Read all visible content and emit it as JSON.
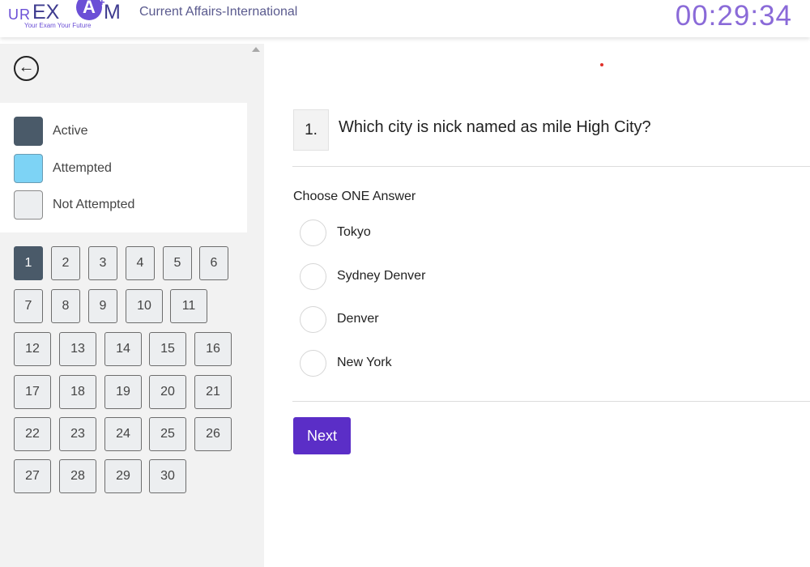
{
  "header": {
    "logo": {
      "ur": "UR",
      "ex": "EX",
      "a": "A",
      "plus": "+",
      "m": "M",
      "tagline": "Your Exam  Your Future"
    },
    "title": "Current Affairs-International",
    "timer": "00:29:34"
  },
  "sidebar": {
    "back_icon": "←",
    "legend": [
      {
        "label": "Active",
        "color": "#4a5a69"
      },
      {
        "label": "Attempted",
        "color": "#7dd3f5"
      },
      {
        "label": "Not Attempted",
        "color": "#eceef0"
      }
    ],
    "question_numbers": [
      [
        "1",
        "2",
        "3",
        "4",
        "5",
        "6"
      ],
      [
        "7",
        "8",
        "9",
        "10",
        "11"
      ],
      [
        "12",
        "13",
        "14",
        "15",
        "16"
      ],
      [
        "17",
        "18",
        "19",
        "20",
        "21"
      ],
      [
        "22",
        "23",
        "24",
        "25",
        "26"
      ],
      [
        "27",
        "28",
        "29",
        "30"
      ]
    ],
    "active_question": "1"
  },
  "question": {
    "number": "1.",
    "text": "Which city is nick named as mile High City?",
    "instruction": "Choose ONE Answer",
    "options": [
      "Tokyo",
      "Sydney Denver",
      "Denver",
      "New York"
    ]
  },
  "actions": {
    "next_label": "Next"
  },
  "colors": {
    "accent": "#5b2ec7",
    "timer": "#8a6ad8"
  }
}
